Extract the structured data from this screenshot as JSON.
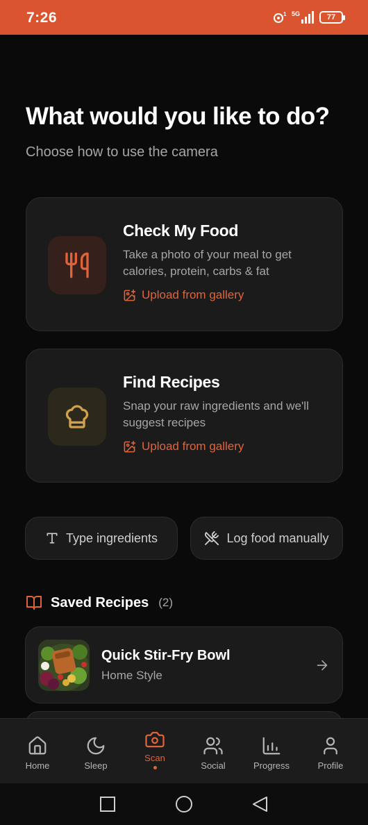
{
  "status": {
    "time": "7:26",
    "battery": "77",
    "network": "5G"
  },
  "page": {
    "title": "What would you like to do?",
    "subtitle": "Choose how to use the camera"
  },
  "cards": [
    {
      "title": "Check My Food",
      "description": "Take a photo of your meal to get calories, protein, carbs & fat",
      "link": "Upload from gallery",
      "icon": "utensils-icon"
    },
    {
      "title": "Find Recipes",
      "description": "Snap your raw ingredients and we'll suggest recipes",
      "link": "Upload from gallery",
      "icon": "chef-hat-icon"
    }
  ],
  "actions": [
    {
      "label": "Type ingredients",
      "icon": "text-icon"
    },
    {
      "label": "Log food manually",
      "icon": "utensils-crossed-icon"
    }
  ],
  "saved": {
    "title": "Saved Recipes",
    "count": "(2)",
    "items": [
      {
        "name": "Quick Stir-Fry Bowl",
        "subtitle": "Home Style"
      }
    ]
  },
  "nav": {
    "items": [
      {
        "label": "Home",
        "icon": "home-icon"
      },
      {
        "label": "Sleep",
        "icon": "moon-icon"
      },
      {
        "label": "Scan",
        "icon": "camera-icon",
        "active": true
      },
      {
        "label": "Social",
        "icon": "users-icon"
      },
      {
        "label": "Progress",
        "icon": "bar-chart-icon"
      },
      {
        "label": "Profile",
        "icon": "user-icon"
      }
    ]
  },
  "colors": {
    "accent": "#e0643a",
    "status_bar": "#d9542f",
    "background": "#0a0a0a",
    "card": "#1b1b1b"
  }
}
